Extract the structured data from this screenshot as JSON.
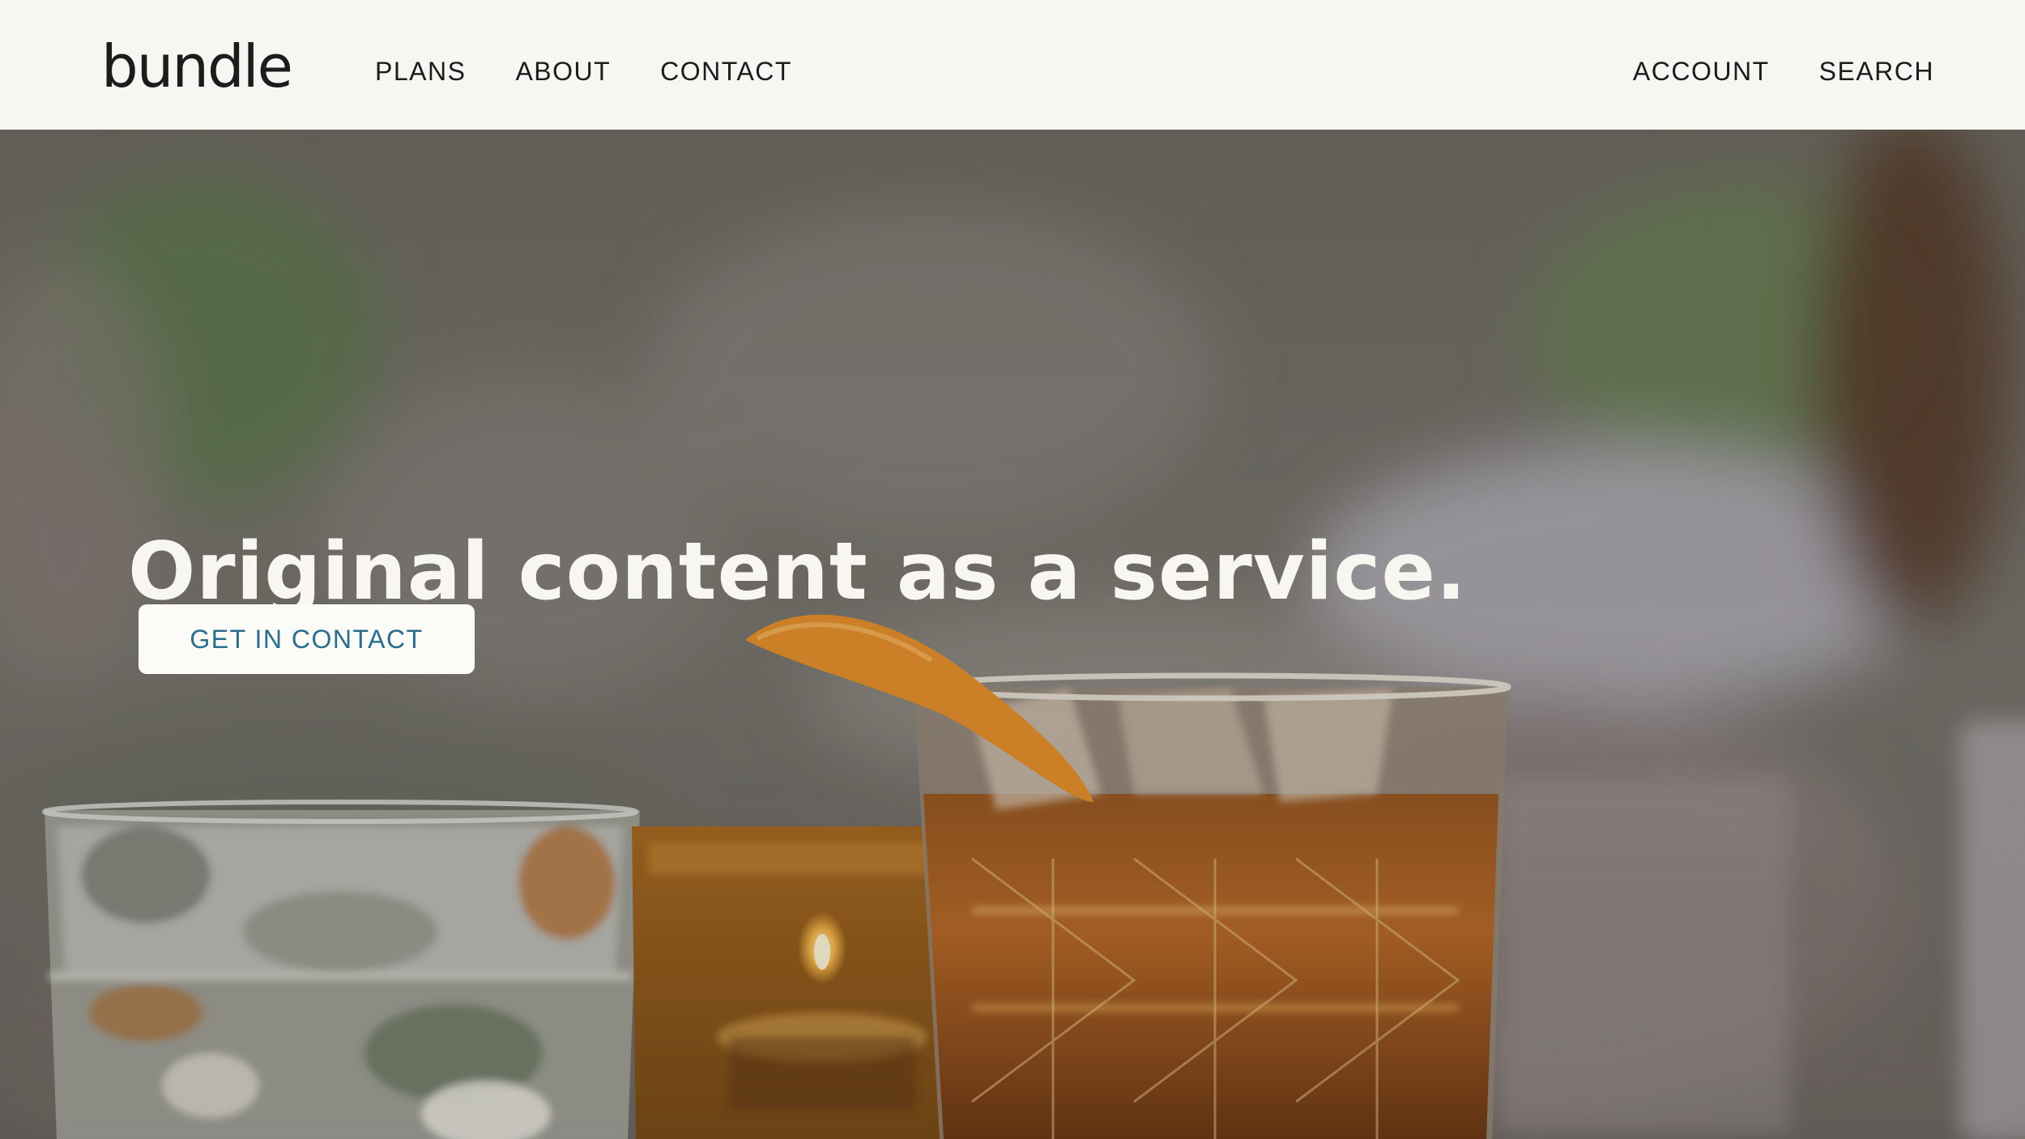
{
  "header": {
    "logo": "bundle",
    "nav_left": [
      "PLANS",
      "ABOUT",
      "CONTACT"
    ],
    "nav_right": [
      "ACCOUNT",
      "SEARCH"
    ]
  },
  "hero": {
    "title": "Original content as a service.",
    "cta_label": "GET IN CONTACT"
  },
  "colors": {
    "header_bg": "#f6f7f2",
    "nav_text": "#1c1c1c",
    "cta_text": "#2c6d8f",
    "hero_title": "#f7f6f0"
  }
}
